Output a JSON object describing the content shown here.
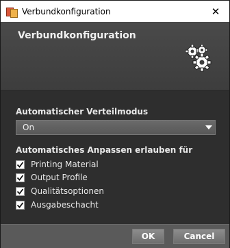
{
  "window": {
    "title": "Verbundkonfiguration",
    "close_glyph": "✕"
  },
  "header": {
    "title": "Verbundkonfiguration",
    "icon": "gears-icon"
  },
  "distribution": {
    "label": "Automatischer Verteilmodus",
    "selected": "On"
  },
  "adjust": {
    "label": "Automatisches Anpassen erlauben für",
    "items": [
      {
        "label": "Printing Material",
        "checked": true
      },
      {
        "label": "Output Profile",
        "checked": true
      },
      {
        "label": "Qualitätsoptionen",
        "checked": true
      },
      {
        "label": "Ausgabeschacht",
        "checked": true
      }
    ]
  },
  "footer": {
    "ok_label": "OK",
    "cancel_label": "Cancel"
  }
}
